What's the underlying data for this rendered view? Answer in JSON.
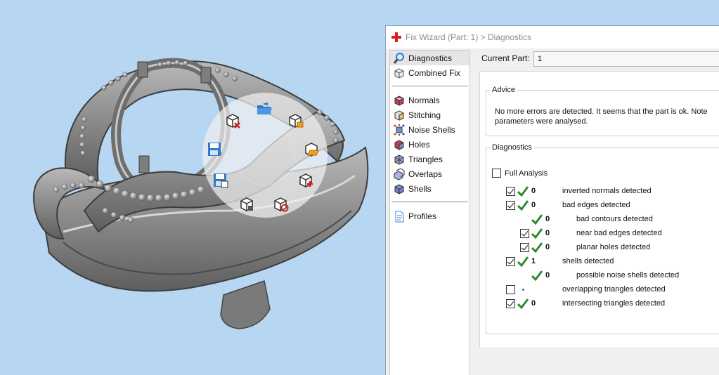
{
  "dialog": {
    "title": "Fix Wizard (Part: 1) > Diagnostics",
    "nav_top": [
      {
        "label": "Diagnostics",
        "icon": "magnifier-icon",
        "selected": true
      },
      {
        "label": "Combined Fix",
        "icon": "combined-fix-icon",
        "selected": false
      }
    ],
    "nav_fixes": [
      {
        "label": "Normals",
        "icon": "normals-cube-icon"
      },
      {
        "label": "Stitching",
        "icon": "stitching-cube-icon"
      },
      {
        "label": "Noise Shells",
        "icon": "noise-shells-icon"
      },
      {
        "label": "Holes",
        "icon": "holes-cube-icon"
      },
      {
        "label": "Triangles",
        "icon": "triangles-icon"
      },
      {
        "label": "Overlaps",
        "icon": "overlaps-icon"
      },
      {
        "label": "Shells",
        "icon": "shells-cube-icon"
      }
    ],
    "nav_bottom": [
      {
        "label": "Profiles",
        "icon": "profiles-doc-icon"
      }
    ],
    "current_part_label": "Current Part:",
    "current_part_value": "1",
    "advice": {
      "legend": "Advice",
      "line1": "No more errors are detected. It seems that the part is ok. Note",
      "line2": "parameters were analysed."
    },
    "diagnostics": {
      "legend": "Diagnostics",
      "full_analysis_label": "Full Analysis",
      "full_analysis_checked": false,
      "rows": [
        {
          "indent": 0,
          "checkbox": true,
          "checked": true,
          "status": "ok",
          "count": "0",
          "label": "inverted normals detected"
        },
        {
          "indent": 0,
          "checkbox": true,
          "checked": true,
          "status": "ok",
          "count": "0",
          "label": "bad edges detected"
        },
        {
          "indent": 1,
          "checkbox": false,
          "checked": false,
          "status": "ok",
          "count": "0",
          "label": "bad contours detected"
        },
        {
          "indent": 1,
          "checkbox": true,
          "checked": true,
          "status": "ok",
          "count": "0",
          "label": "near bad edges detected"
        },
        {
          "indent": 1,
          "checkbox": true,
          "checked": true,
          "status": "ok",
          "count": "0",
          "label": "planar holes detected"
        },
        {
          "indent": 0,
          "checkbox": true,
          "checked": true,
          "status": "ok",
          "count": "1",
          "label": "shells detected"
        },
        {
          "indent": 1,
          "checkbox": false,
          "checked": false,
          "status": "ok",
          "count": "0",
          "label": "possible noise shells detected"
        },
        {
          "indent": 0,
          "checkbox": true,
          "checked": false,
          "status": "pending",
          "count": "",
          "label": "overlapping triangles detected"
        },
        {
          "indent": 0,
          "checkbox": true,
          "checked": true,
          "status": "ok",
          "count": "0",
          "label": "intersecting triangles detected"
        }
      ]
    }
  },
  "radial_menu": {
    "buttons": [
      {
        "icon": "folder-open-icon"
      },
      {
        "icon": "cube-delete-icon"
      },
      {
        "icon": "cube-box-icon"
      },
      {
        "icon": "save-icon"
      },
      {
        "icon": "box-export-icon"
      },
      {
        "icon": "save-as-icon"
      },
      {
        "icon": "cube-add-icon"
      },
      {
        "icon": "cube-hand-icon"
      },
      {
        "icon": "cube-rotate-icon"
      }
    ]
  },
  "colors": {
    "viewport_bg": "#b7d6f2",
    "ok_green": "#2e8b2e",
    "ring_gray": "#8c8c8c",
    "app_red": "#d81e1e"
  }
}
